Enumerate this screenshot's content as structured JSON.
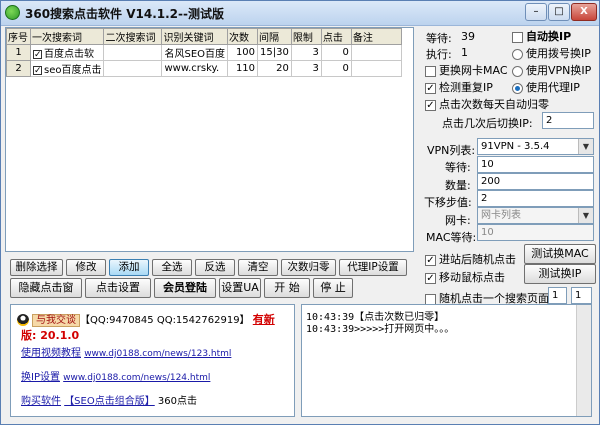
{
  "window": {
    "title": "360搜索点击软件 V14.1.2--测试版",
    "min": "–",
    "max": "□",
    "close": "X"
  },
  "grid": {
    "columns": [
      "序号",
      "一次搜索词",
      "二次搜索词",
      "识别关键词",
      "次数",
      "间隔",
      "限制",
      "点击",
      "备注"
    ],
    "rows": [
      {
        "no": "1",
        "checked": true,
        "kw1": "百度点击软",
        "kw2": "",
        "ident": "名风SEO百度",
        "times": "100",
        "interval": "15",
        "interval2": "30",
        "limit": "3",
        "clicks": "0",
        "note": ""
      },
      {
        "no": "2",
        "checked": true,
        "kw1": "seo百度点击",
        "kw2": "",
        "ident": "www.crsky.",
        "times": "110",
        "interval": "20",
        "interval2": "",
        "limit": "3",
        "clicks": "0",
        "note": ""
      }
    ]
  },
  "status": {
    "waiting_label": "等待:",
    "waiting_value": "39",
    "executed_label": "执行:",
    "executed_value": "1"
  },
  "options": {
    "auto_switch_ip": "自动换IP",
    "use_dialup": "使用拨号换IP",
    "change_mac": "更换网卡MAC",
    "use_vpn": "使用VPN换IP",
    "detect_dup_ip": "检测重复IP",
    "use_proxy": "使用代理IP",
    "daily_reset": "点击次数每天自动归零",
    "switch_after_label": "点击几次后切换IP:",
    "switch_after_value": "2"
  },
  "vpn": {
    "list_label": "VPN列表:",
    "list_value": "91VPN - 3.5.4",
    "wait_label": "等待:",
    "wait_value": "10",
    "count_label": "数量:",
    "count_value": "200",
    "step_label": "下移步值:",
    "step_value": "2",
    "nic_label": "网卡:",
    "nic_value": "网卡列表",
    "mac_wait_label": "MAC等待:",
    "mac_wait_value": "10"
  },
  "buttons_row1": [
    "删除选择",
    "修改",
    "添加",
    "全选",
    "反选",
    "清空",
    "次数归零",
    "代理IP设置"
  ],
  "buttons_row2": [
    "隐藏点击窗",
    "点击设置",
    "会员登陆",
    "设置UA",
    "开 始",
    "停 止"
  ],
  "right_actions": {
    "random_click": "进站后随机点击",
    "test_mac": "测试换MAC",
    "move_mouse": "移动鼠标点击",
    "test_ip": "测试换IP",
    "random_page": "随机点击一个搜索页面",
    "page_from": "1",
    "page_to": "1"
  },
  "info": {
    "qq_link": "与我交谈",
    "qq_text": "【QQ:9470845 QQ:1542762919】",
    "new_version_label": "有新",
    "version": "版: 20.1.0",
    "tutorial_label": "使用视频教程",
    "tutorial_url": "www.dj0188.com/news/123.html",
    "ip_label": "换IP设置",
    "ip_url": "www.dj0188.com/news/124.html",
    "buy_label": "购买软件",
    "combo_label": "【SEO点击组合版】",
    "combo_suffix": "360点击"
  },
  "log": {
    "lines": [
      "10:43:39【点击次数已归零】",
      "10:43:39>>>>>打开网页中。。。"
    ]
  },
  "colors": {
    "title_gradient_top": "#dbe8f8",
    "accent_blue": "#1b6fbf",
    "link_blue": "#1a1aa8",
    "red": "#d20000"
  }
}
